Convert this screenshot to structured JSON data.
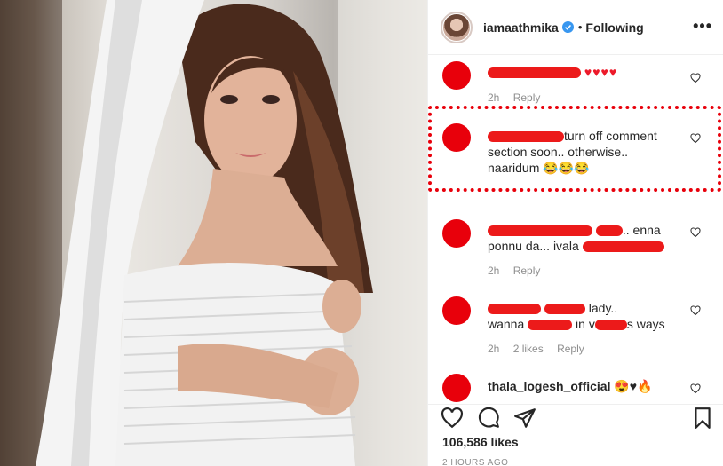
{
  "header": {
    "username": "iamaathmika",
    "separator": "•",
    "follow_status": "Following",
    "more_label": "•••"
  },
  "comments": [
    {
      "text": "",
      "emojis": "♥♥♥♥",
      "time": "2h",
      "reply": "Reply",
      "likes": ""
    },
    {
      "text": "turn off comment section soon.. otherwise.. naaridum 😂😂😂",
      "highlighted": true,
      "time": "",
      "reply": "",
      "likes": ""
    },
    {
      "text": ".. enna ponnu da... ivala",
      "time": "2h",
      "reply": "Reply",
      "likes": ""
    },
    {
      "text": "lady.. wanna in ways",
      "time": "2h",
      "reply": "Reply",
      "likes": "2 likes"
    },
    {
      "username": "thala_logesh_official",
      "emojis": "😍♥🔥",
      "time": "",
      "reply": "",
      "likes": ""
    }
  ],
  "c1": {
    "line1": "turn off comment",
    "line2": "section soon.. otherwise..",
    "line3": "naaridum 😂😂😂"
  },
  "c2": {
    "word1": ".. enna",
    "word2": "ponnu da... ivala"
  },
  "c3": {
    "word1": "lady..",
    "word2": "wanna",
    "word3": "in v",
    "word4": "s ways"
  },
  "engagement": {
    "likes": "106,586 likes",
    "posted": "2 HOURS AGO"
  }
}
